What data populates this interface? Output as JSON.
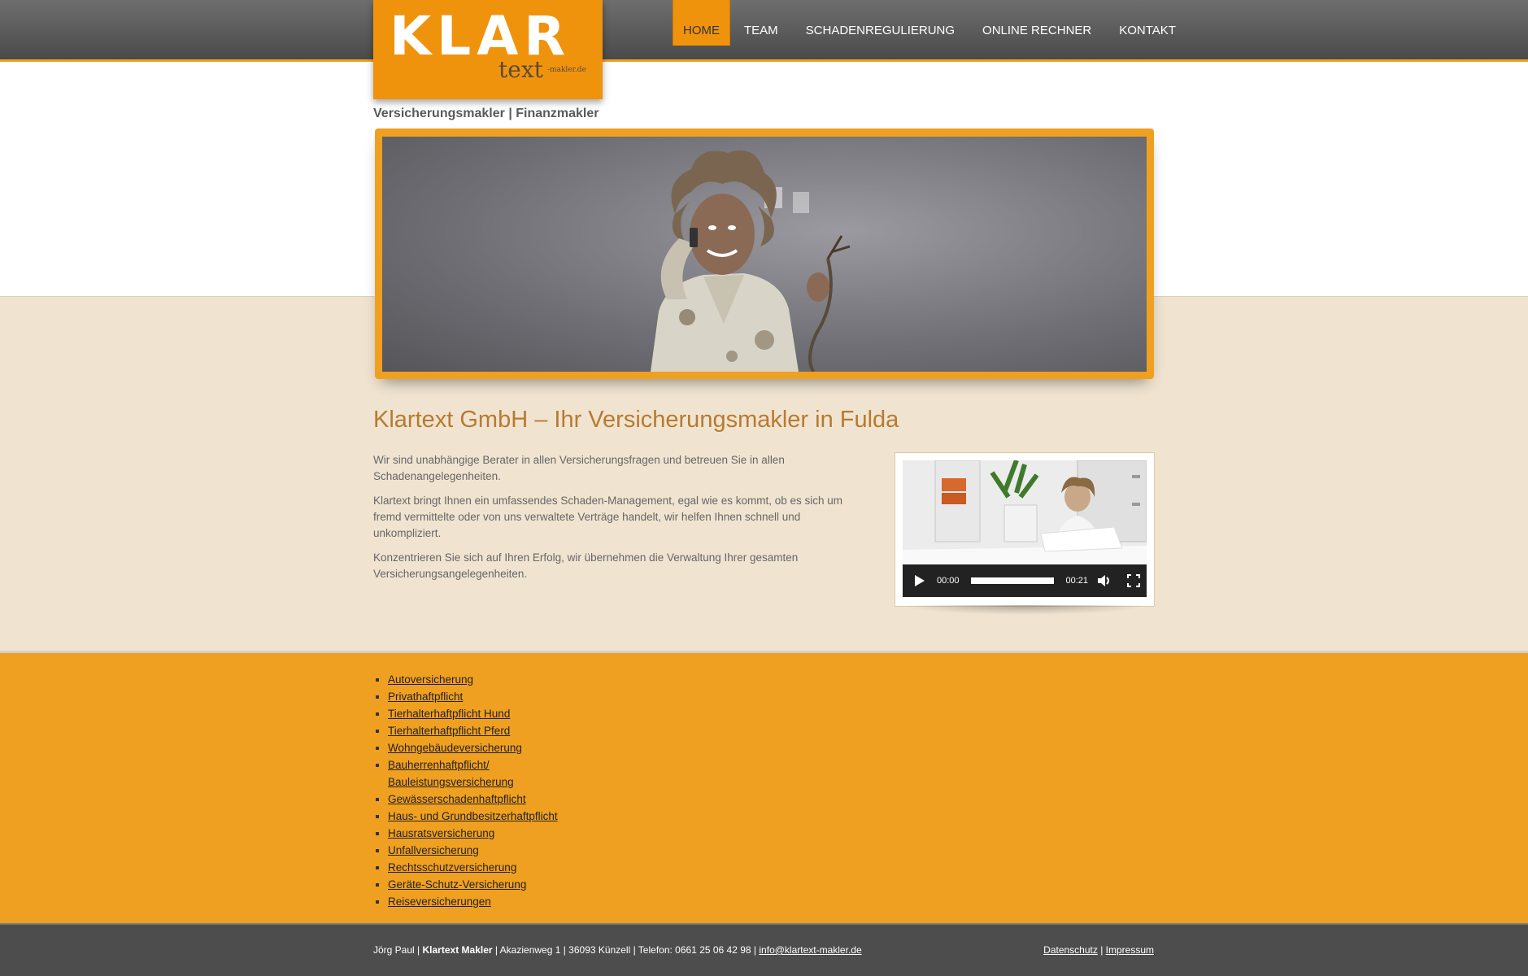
{
  "logo": {
    "main": "KLAR",
    "sub": "text",
    "suffix": "-makler.de"
  },
  "tagline": "Versicherungsmakler | Finanzmakler",
  "nav": [
    {
      "label": "HOME",
      "active": true
    },
    {
      "label": "TEAM"
    },
    {
      "label": "SCHADENREGULIERUNG"
    },
    {
      "label": "ONLINE RECHNER"
    },
    {
      "label": "KONTAKT"
    }
  ],
  "main": {
    "heading": "Klartext GmbH – Ihr Versicherungsmakler in Fulda",
    "paragraphs": [
      "Wir sind unabhängige Berater in allen Versicherungsfragen und betreuen Sie in allen Schadenangelegenheiten.",
      "Klartext bringt Ihnen ein umfassendes Schaden-Management, egal wie es kommt, ob es sich um fremd vermittelte oder von uns verwaltete Verträge handelt, wir helfen Ihnen schnell und unkompliziert.",
      "Konzentrieren Sie sich auf Ihren Erfolg, wir übernehmen die Verwaltung Ihrer gesamten Versicherungsangelegenheiten."
    ]
  },
  "video": {
    "current_time": "00:00",
    "duration": "00:21",
    "progress": 0
  },
  "insurance_links": [
    "Autoversicherung",
    "Privathaftpflicht",
    "Tierhalterhaftpflicht Hund",
    "Tierhalterhaftpflicht Pferd",
    "Wohngebäudeversicherung",
    "Bauherrenhaftpflicht/ Bauleistungsversicherung",
    "Gewässerschadenhaftpflicht",
    "Haus- und Grundbesitzerhaftpflicht",
    "Hausratsversicherung",
    "Unfallversicherung",
    "Rechtsschutzversicherung",
    "Geräte-Schutz-Versicherung",
    "Reiseversicherungen"
  ],
  "footer": {
    "name": "Jörg Paul",
    "company": "Klartext Makler",
    "address": "Akazienweg 1 | 36093 Künzell | Telefon: 0661 25 06 42 98",
    "email": "info@klartext-makler.de",
    "datenschutz": "Datenschutz",
    "impressum": "Impressum"
  },
  "colors": {
    "accent": "#f0a020",
    "logo_bg": "#f0930c",
    "header_bg": "#5a5a5a",
    "content_bg": "#f0e4d0",
    "heading": "#b87a30"
  },
  "icons": {
    "play": "play-icon",
    "volume": "volume-icon",
    "fullscreen": "fullscreen-icon"
  }
}
